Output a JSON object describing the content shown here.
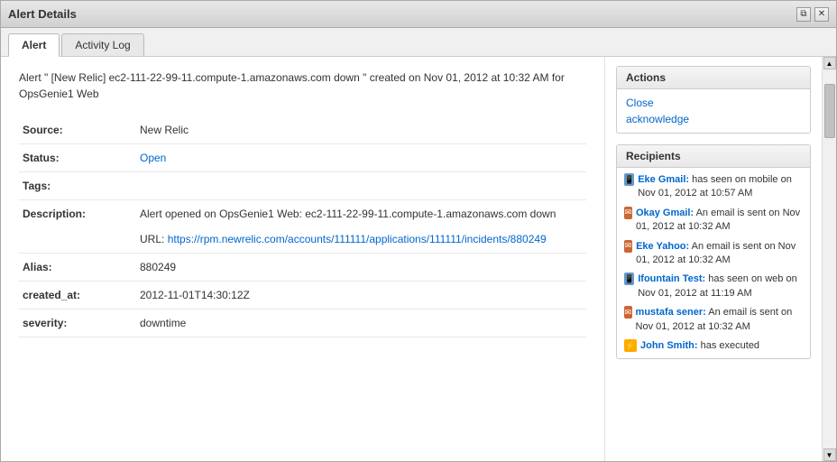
{
  "dialog": {
    "title": "Alert Details",
    "controls": {
      "restore_label": "⧉",
      "close_label": "✕"
    }
  },
  "tabs": [
    {
      "id": "alert",
      "label": "Alert",
      "active": true
    },
    {
      "id": "activity-log",
      "label": "Activity Log",
      "active": false
    }
  ],
  "alert": {
    "summary": "Alert \" [New Relic] ec2-111-22-99-11.compute-1.amazonaws.com down \" created on Nov 01, 2012 at 10:32 AM for OpsGenie1 Web",
    "source_label": "Source:",
    "source_value": "New Relic",
    "status_label": "Status:",
    "status_value": "Open",
    "tags_label": "Tags:",
    "tags_value": "",
    "description_label": "Description:",
    "description_text": "Alert opened on OpsGenie1 Web: ec2-111-22-99-11.compute-1.amazonaws.com down",
    "description_url_label": "URL:",
    "description_url_text": "https://rpm.newrelic.com/accounts/111111/applications/111111/incidents/880249",
    "description_url_href": "https://rpm.newrelic.com/accounts/111111/applications/111111/incidents/880249",
    "alias_label": "Alias:",
    "alias_value": "880249",
    "created_at_label": "created_at:",
    "created_at_value": "2012-11-01T14:30:12Z",
    "severity_label": "severity:",
    "severity_value": "downtime"
  },
  "actions": {
    "header": "Actions",
    "close_label": "Close",
    "acknowledge_label": "acknowledge"
  },
  "recipients": {
    "header": "Recipients",
    "items": [
      {
        "icon_type": "mobile",
        "name": "Eke Gmail:",
        "text": " has seen on mobile on Nov 01, 2012 at 10:57 AM"
      },
      {
        "icon_type": "email",
        "name": "Okay Gmail:",
        "text": " An email is sent on Nov 01, 2012 at 10:32 AM"
      },
      {
        "icon_type": "email",
        "name": "Eke Yahoo:",
        "text": " An email is sent on Nov 01, 2012 at 10:32 AM"
      },
      {
        "icon_type": "mobile",
        "name": "Ifountain Test:",
        "text": " has seen on web on Nov 01, 2012 at 11:19 AM"
      },
      {
        "icon_type": "email",
        "name": "mustafa sener:",
        "text": " An email is sent on Nov 01, 2012 at 10:32 AM"
      },
      {
        "icon_type": "execute",
        "name": "John Smith:",
        "text": " has executed"
      }
    ]
  }
}
